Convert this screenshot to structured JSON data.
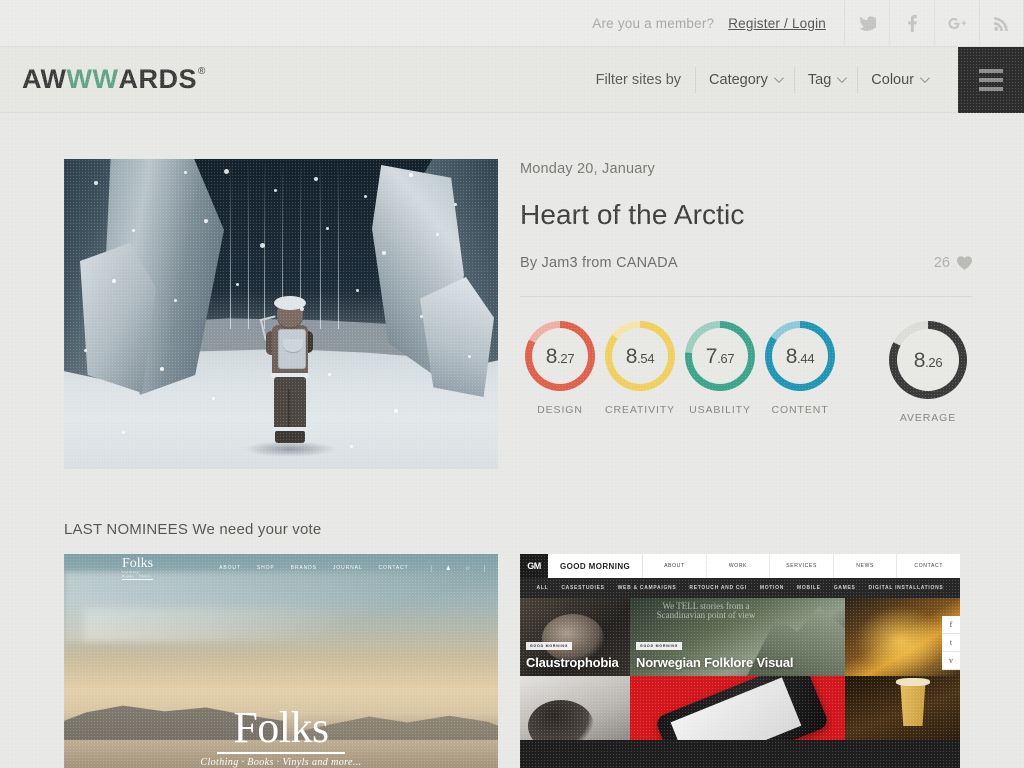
{
  "topbar": {
    "member_question": "Are you a member?",
    "register_login": "Register / Login",
    "social": [
      {
        "name": "twitter-icon",
        "label": "Twitter"
      },
      {
        "name": "facebook-icon",
        "label": "Facebook"
      },
      {
        "name": "google-plus-icon",
        "label": "Google Plus"
      },
      {
        "name": "rss-icon",
        "label": "RSS"
      }
    ]
  },
  "header": {
    "logo_part1": "AW",
    "logo_part2": "WW",
    "logo_part3": "ARDS",
    "logo_registered": "®",
    "logo_green": "#60a385",
    "filter_label": "Filter sites by",
    "nav": [
      {
        "label": "Category",
        "has_caret": true
      },
      {
        "label": "Tag",
        "has_caret": true
      },
      {
        "label": "Colour",
        "has_caret": true
      }
    ],
    "menu_button": "menu-icon"
  },
  "hero": {
    "date": "Monday 20, January",
    "title": "Heart of the Arctic",
    "byline": "By Jam3 from CANADA",
    "likes_count": "26",
    "likes_icon": "heart-icon",
    "image_alt": "Arctic ice canyon with a lone figure carrying a backpack"
  },
  "scores": [
    {
      "label": "DESIGN",
      "value": "8",
      "decimal": ".27",
      "color": "#e0604a",
      "track": "#edb0a4",
      "percent": 82.7
    },
    {
      "label": "CREATIVITY",
      "value": "8",
      "decimal": ".54",
      "color": "#f0d05f",
      "track": "#f6e5a9",
      "percent": 85.4
    },
    {
      "label": "USABILITY",
      "value": "7",
      "decimal": ".67",
      "color": "#3ba58c",
      "track": "#9ccfc0",
      "percent": 76.7
    },
    {
      "label": "CONTENT",
      "value": "8",
      "decimal": ".44",
      "color": "#1f96b4",
      "track": "#8ec9da",
      "percent": 84.4
    }
  ],
  "average": {
    "label": "AVERAGE",
    "value": "8",
    "decimal": ".26",
    "color": "#3a3a3a",
    "track": "#dcdcd8",
    "percent": 82.6
  },
  "nominees": {
    "heading": "LAST NOMINEES We need your vote",
    "items": [
      {
        "site_name": "Folks",
        "logo_sub": "Clothing · Books · Vinyls",
        "nav": [
          "ABOUT",
          "SHOP",
          "BRANDS",
          "JOURNAL",
          "CONTACT"
        ],
        "icons": [
          "user-icon",
          "cart-icon",
          "search-icon"
        ],
        "hero_title": "Folks",
        "hero_tagline": "Clothing · Books · Vinyls and more..."
      },
      {
        "site_name": "GOOD MORNING",
        "mark": "GM",
        "nav": [
          "ABOUT",
          "WORK",
          "SERVICES",
          "NEWS",
          "CONTACT"
        ],
        "subnav": [
          "ALL",
          "CASESTUDIES",
          "WEB & CAMPAIGNS",
          "RETOUCH AND CGI",
          "MOTION",
          "MOBILE",
          "GAMES",
          "DIGITAL INSTALLATIONS"
        ],
        "cards": [
          {
            "badge": "GOOD MORNING",
            "title": "Claustrophobia"
          },
          {
            "badge": "GOOD MORNING",
            "title": "Norwegian Folklore Visual"
          }
        ],
        "type_art": "We TELL stories from a Scandinavian point of view",
        "side_buttons": [
          "f",
          "t",
          "v"
        ]
      }
    ]
  }
}
